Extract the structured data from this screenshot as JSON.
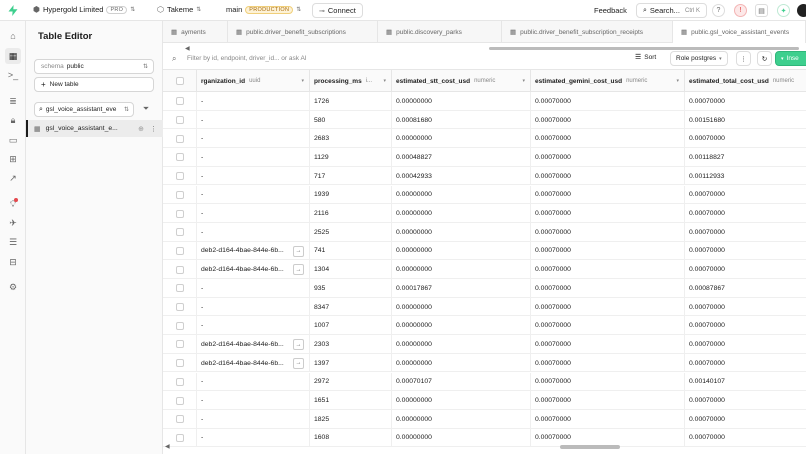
{
  "topbar": {
    "org_name": "Hypergold Limited",
    "org_plan": "PRO",
    "project_name": "Takeme",
    "branch_name": "main",
    "branch_env": "PRODUCTION",
    "connect_label": "Connect",
    "feedback_label": "Feedback",
    "search_label": "Search...",
    "search_shortcut": "Ctrl K"
  },
  "sidebar": {
    "title": "Table Editor",
    "schema_prefix": "schema",
    "schema_value": "public",
    "new_table_label": "New table",
    "search_value": "gsl_voice_assistant_eve",
    "table_item": "gsl_voice_assistant_e..."
  },
  "tabs": [
    {
      "label": "ayments",
      "active": false
    },
    {
      "label": "public.driver_benefit_subscriptions",
      "active": false
    },
    {
      "label": "public.discovery_parks",
      "active": false
    },
    {
      "label": "public.driver_benefit_subscription_receipts",
      "active": false
    },
    {
      "label": "public.gsl_voice_assistant_events",
      "active": true
    }
  ],
  "toolbar": {
    "filter_placeholder": "Filter by id, endpoint, driver_id... or ask AI",
    "sort_label": "Sort",
    "role_label": "Role postgres",
    "insert_label": "Inse"
  },
  "grid": {
    "columns": [
      {
        "name": "rganization_id",
        "type": "uuid"
      },
      {
        "name": "processing_ms",
        "type": "i..."
      },
      {
        "name": "estimated_stt_cost_usd",
        "type": "numeric"
      },
      {
        "name": "estimated_gemini_cost_usd",
        "type": "numeric"
      },
      {
        "name": "estimated_total_cost_usd",
        "type": "numeric"
      }
    ],
    "rows": [
      {
        "org": "-",
        "ms": "1726",
        "stt": "0.00000000",
        "gem": "0.00070000",
        "tot": "0.00070000",
        "link": false
      },
      {
        "org": "-",
        "ms": "580",
        "stt": "0.00081680",
        "gem": "0.00070000",
        "tot": "0.00151680",
        "link": false
      },
      {
        "org": "-",
        "ms": "2683",
        "stt": "0.00000000",
        "gem": "0.00070000",
        "tot": "0.00070000",
        "link": false
      },
      {
        "org": "-",
        "ms": "1129",
        "stt": "0.00048827",
        "gem": "0.00070000",
        "tot": "0.00118827",
        "link": false
      },
      {
        "org": "-",
        "ms": "717",
        "stt": "0.00042933",
        "gem": "0.00070000",
        "tot": "0.00112933",
        "link": false
      },
      {
        "org": "-",
        "ms": "1939",
        "stt": "0.00000000",
        "gem": "0.00070000",
        "tot": "0.00070000",
        "link": false
      },
      {
        "org": "-",
        "ms": "2116",
        "stt": "0.00000000",
        "gem": "0.00070000",
        "tot": "0.00070000",
        "link": false
      },
      {
        "org": "-",
        "ms": "2525",
        "stt": "0.00000000",
        "gem": "0.00070000",
        "tot": "0.00070000",
        "link": false
      },
      {
        "org": "deb2-d164-4bae-844e-6b...",
        "ms": "741",
        "stt": "0.00000000",
        "gem": "0.00070000",
        "tot": "0.00070000",
        "link": true
      },
      {
        "org": "deb2-d164-4bae-844e-6b...",
        "ms": "1304",
        "stt": "0.00000000",
        "gem": "0.00070000",
        "tot": "0.00070000",
        "link": true
      },
      {
        "org": "-",
        "ms": "935",
        "stt": "0.00017867",
        "gem": "0.00070000",
        "tot": "0.00087867",
        "link": false
      },
      {
        "org": "-",
        "ms": "8347",
        "stt": "0.00000000",
        "gem": "0.00070000",
        "tot": "0.00070000",
        "link": false
      },
      {
        "org": "-",
        "ms": "1007",
        "stt": "0.00000000",
        "gem": "0.00070000",
        "tot": "0.00070000",
        "link": false
      },
      {
        "org": "deb2-d164-4bae-844e-6b...",
        "ms": "2303",
        "stt": "0.00000000",
        "gem": "0.00070000",
        "tot": "0.00070000",
        "link": true
      },
      {
        "org": "deb2-d164-4bae-844e-6b...",
        "ms": "1397",
        "stt": "0.00000000",
        "gem": "0.00070000",
        "tot": "0.00070000",
        "link": true
      },
      {
        "org": "-",
        "ms": "2972",
        "stt": "0.00070107",
        "gem": "0.00070000",
        "tot": "0.00140107",
        "link": false
      },
      {
        "org": "-",
        "ms": "1651",
        "stt": "0.00000000",
        "gem": "0.00070000",
        "tot": "0.00070000",
        "link": false
      },
      {
        "org": "-",
        "ms": "1825",
        "stt": "0.00000000",
        "gem": "0.00070000",
        "tot": "0.00070000",
        "link": false
      },
      {
        "org": "-",
        "ms": "1608",
        "stt": "0.00000000",
        "gem": "0.00070000",
        "tot": "0.00070000",
        "link": false
      }
    ]
  },
  "colors": {
    "brand": "#3ecf8e",
    "production_badge": "#f0cf7a"
  }
}
